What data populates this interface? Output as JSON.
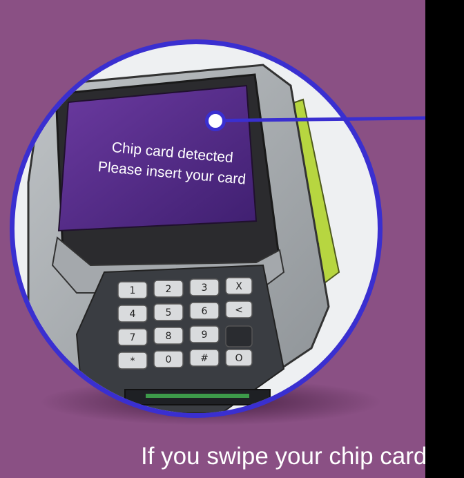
{
  "screen": {
    "line1": "Chip card detected",
    "line2": "Please insert your card"
  },
  "caption": "If you swipe your chip card",
  "keypad": {
    "keys": [
      "1",
      "2",
      "3",
      "X",
      "4",
      "5",
      "6",
      "<",
      "7",
      "8",
      "9",
      "",
      "*",
      "0",
      "#",
      "O"
    ]
  },
  "colors": {
    "background": "#8a5084",
    "ring": "#3a2fd0",
    "screen": "#5a2d8e",
    "card": "#b7d640"
  }
}
